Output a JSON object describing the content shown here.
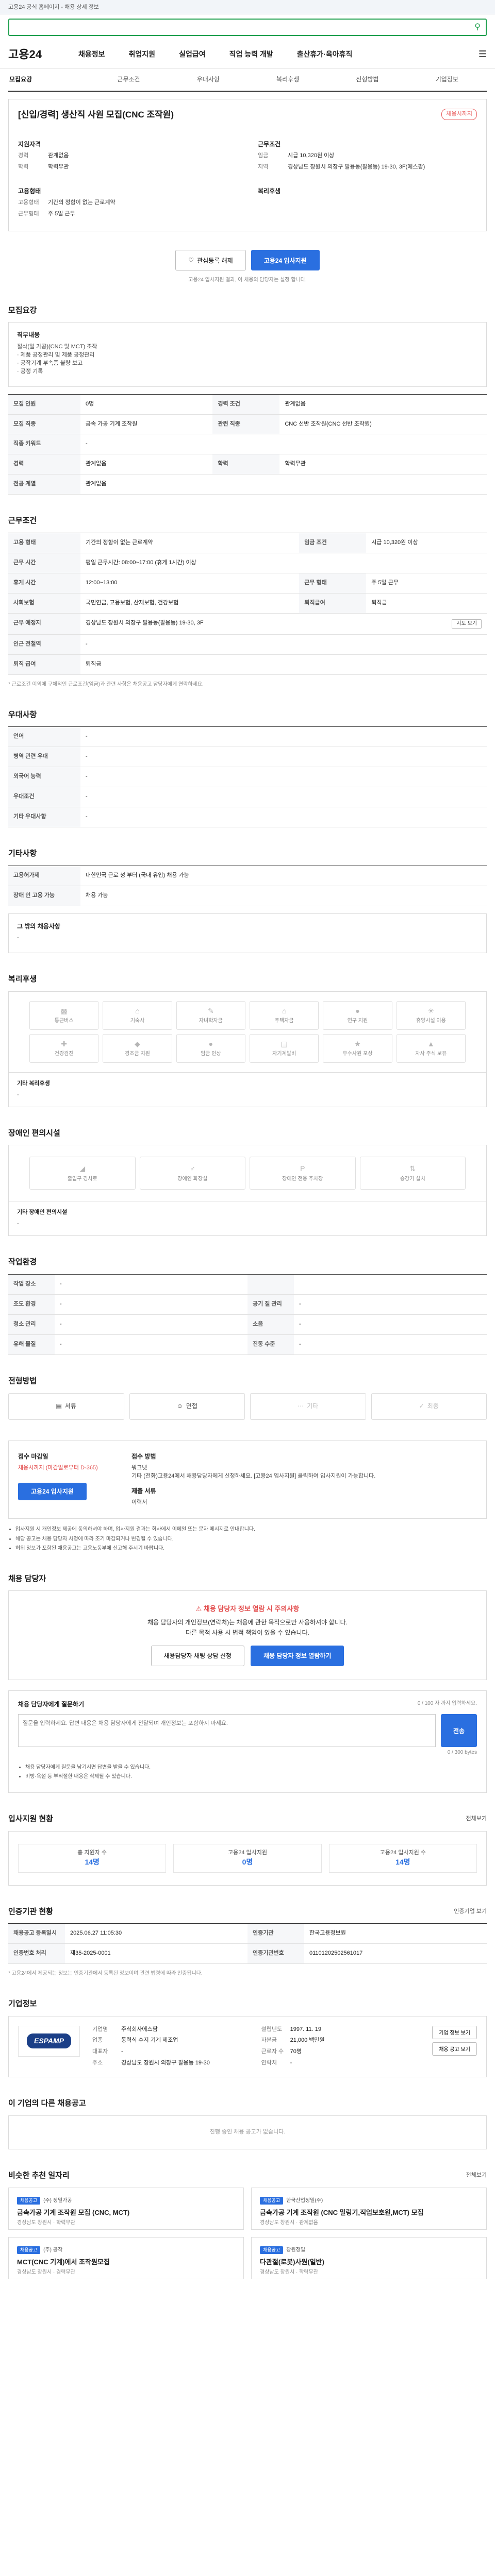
{
  "topbar": {
    "text": "고용24 공식 홈페이지 - 채용 상세 정보"
  },
  "search": {
    "placeholder": ""
  },
  "gnb": {
    "logo": "고용24",
    "items": [
      "채용정보",
      "취업지원",
      "실업급여",
      "직업 능력 개발",
      "출산휴가·육아휴직"
    ]
  },
  "tabs": [
    "모집요강",
    "근무조건",
    "우대사항",
    "복리후생",
    "전형방법",
    "기업정보"
  ],
  "title": {
    "job_title": "[신입/경력] 생산직 사원 모집(CNC 조작원)",
    "deadline": "채용시까지"
  },
  "summary": {
    "left_heading": "지원자격",
    "right_heading": "근무조건",
    "rows_left": [
      [
        "경력",
        "관계없음"
      ],
      [
        "학력",
        "학력무관"
      ]
    ],
    "rows_right": [
      [
        "임금",
        "시급 10,320원 이상"
      ],
      [
        "지역",
        "경상남도 창원시 의창구 팔용동(팔용동) 19-30, 3F(에스팜)"
      ]
    ],
    "left_heading2": "고용형태",
    "right_heading2": "복리후생",
    "rows_left2": [
      [
        "고용형태",
        "기간의 정함이 없는 근로계약"
      ],
      [
        "근무형태",
        "주 5일 근무"
      ]
    ]
  },
  "actions": {
    "scrap": "관심등록 해제",
    "apply": "고용24 입사지원"
  },
  "apply_note": "고용24 입사지원 결과, 이 채용의 담당자는 설정 합니다.",
  "recruit": {
    "section": "모집요강",
    "duty_title": "직무내용",
    "duty_lines": [
      "절삭(일 가공)(CNC 및 MCT) 조작",
      "· 제품 공정관리 및 제품 공정관리",
      "· 공작기계 부속품 불량 보고",
      "· 공정 기록"
    ],
    "rows": [
      [
        "모집 인원",
        "0명",
        "경력 조건",
        "관계없음"
      ],
      [
        "모집 직종",
        "금속 가공 기계 조작원",
        "관련 직종",
        "CNC 선반 조작원(CNC 선반 조작원)"
      ],
      [
        "직종 키워드",
        "-",
        "",
        ""
      ],
      [
        "경력",
        "관계없음",
        "학력",
        "학력무관"
      ],
      [
        "전공 계열",
        "관계없음",
        "",
        ""
      ]
    ]
  },
  "work": {
    "section": "근무조건",
    "rows": [
      [
        "고용 형태",
        "기간의 정함이 없는 근로계약",
        "임금 조건",
        "시급 10,320원 이상"
      ],
      [
        "근무 시간",
        "평일 근무시간: 08:00~17:00 (휴게 1시간) 이상",
        "",
        ""
      ],
      [
        "휴게 시간",
        "12:00~13:00",
        "근무 형태",
        "주 5일 근무"
      ],
      [
        "사회보험",
        "국민연금, 고용보험, 산재보험, 건강보험",
        "퇴직급여",
        "퇴직금"
      ],
      [
        "근무 예정지",
        "경상남도 창원시 의창구 팔용동(팔용동) 19-30, 3F",
        "",
        ""
      ],
      [
        "인근 전철역",
        "-",
        "",
        ""
      ],
      [
        "퇴직 급여",
        "퇴직금",
        "",
        ""
      ]
    ],
    "map_btn": "지도 보기",
    "note": "* 근로조건 이외에 구체적인 근로조건(임금)과 관련 사항은 채용공고 담당자에게 연락하세요."
  },
  "prefer": {
    "section": "우대사항",
    "rows": [
      [
        "언어",
        "-"
      ],
      [
        "병역 관련 우대",
        "-"
      ],
      [
        "외국어 능력",
        "-"
      ],
      [
        "우대조건",
        "-"
      ],
      [
        "기타 우대사항",
        "-"
      ]
    ]
  },
  "etc": {
    "section": "기타사항",
    "rows": [
      [
        "고용허가제",
        "대한민국 근로 성 부터 (국내 유입) 채용 가능"
      ],
      [
        "장애 인 고용 가능",
        "채용 가능"
      ]
    ],
    "sub_title": "그 밖의 채용사항",
    "sub_text": "-"
  },
  "welfare": {
    "section": "복리후생",
    "items": [
      "통근버스",
      "기숙사",
      "자녀학자금",
      "주택자금",
      "연구 지원",
      "휴양시설 이용",
      "건강검진",
      "경조금 지원",
      "임금 인상",
      "자기계발비",
      "우수사원 포상",
      "자사 주식 보유"
    ],
    "sub_title": "기타 복리후생",
    "sub_text": "-"
  },
  "disability": {
    "section": "장애인 편의시설",
    "items": [
      "출입구 경사로",
      "장애인 화장실",
      "장애인 전용 주차장",
      "승강기 설치"
    ],
    "sub_title": "기타 장애인 편의시설",
    "sub_text": "-"
  },
  "env": {
    "section": "작업환경",
    "rows": [
      [
        "작업 장소",
        "-",
        "",
        ""
      ],
      [
        "조도 환경",
        "-",
        "공기 질 관리",
        "-"
      ],
      [
        "청소 관리",
        "-",
        "소음",
        "-"
      ],
      [
        "유해 물질",
        "-",
        "진동 수준",
        "-"
      ]
    ]
  },
  "process": {
    "section": "전형방법",
    "steps": [
      "서류",
      "면접",
      "기타",
      "최종"
    ]
  },
  "apply": {
    "left_title": "접수 마감일",
    "left_text": "채용시까지 (마감일로부터 D-365)",
    "apply_btn": "고용24 입사지원",
    "right_title": "접수 방법",
    "right_lines": [
      "워크넷",
      "기타 (전화)고용24에서 채용담당자에게 신청하세요. [고용24 입사지원] 클릭하여 입사지원이 가능합니다."
    ],
    "doc_title": "제출 서류",
    "doc_text": "이력서",
    "bullets": [
      "입사지원 시 개인정보 제공에 동의하셔야 하며, 입사지원 결과는 회사에서 이메일 또는 문자 메시지로 안내합니다.",
      "해당 공고는 채용 담당자 사정에 따라 조기 마감되거나 변경될 수 있습니다.",
      "허위 정보가 포함된 채용공고는 고용노동부에 신고해 주시기 바랍니다."
    ]
  },
  "manager": {
    "section": "채용 담당자",
    "badge": "채용 담당자 정보 열람 시 주의사항",
    "text1": "채용 담당자의 개인정보(연락처)는 채용에 관한 목적으로만 사용하셔야 합니다.",
    "text2": "다른 목적 사용 시 법적 책임이 있을 수 있습니다.",
    "btn_chat": "채용담당자 채팅 상담 신청",
    "btn_view": "채용 담당자 정보 열람하기",
    "q_title": "채용 담당자에게 질문하기",
    "q_hint": "0 / 100 자 까지 입력하세요.",
    "q_placeholder": "질문을 입력하세요. 답변 내용은 채용 담당자에게 전달되며 개인정보는 포함하지 마세요.",
    "q_btn": "전송",
    "q_counter": "0 / 300 bytes",
    "notes": [
      "채용 담당자에게 질문을 남기시면 답변을 받을 수 있습니다.",
      "비방·욕설 등 부적절한 내용은 삭제될 수 있습니다."
    ]
  },
  "stats": {
    "section": "입사지원 현황",
    "right": "전체보기",
    "items": [
      [
        "총 지원자 수",
        "14명"
      ],
      [
        "고용24 입사지원",
        "0명"
      ],
      [
        "고용24 입사지원 수",
        "14명"
      ]
    ]
  },
  "cert": {
    "section": "인증기관 현황",
    "right": "인증기업 보기",
    "rows": [
      [
        "채용공고 등록일시",
        "2025.06.27 11:05:30",
        "인증기관",
        "한국고용정보원"
      ],
      [
        "인증번호 처리",
        "제35-2025-0001",
        "인증기관번호",
        "01101202502561017"
      ]
    ],
    "note": "* 고용24에서 제공되는 정보는 인증기관에서 등록된 정보이며 관련 법령에 따라 인증됩니다."
  },
  "company": {
    "section": "기업정보",
    "logo_text": "ESPAMP",
    "btn_info": "기업 정보 보기",
    "btn_jobs": "채용 공고 보기",
    "rows": [
      [
        "기업명",
        "주식회사에스팜"
      ],
      [
        "업종",
        "동력식 수지 기계 제조업"
      ],
      [
        "대표자",
        "-"
      ],
      [
        "설립년도",
        "1997. 11. 19"
      ],
      [
        "자본금",
        "21,000 백만원"
      ],
      [
        "근로자 수",
        "70명"
      ],
      [
        "주소",
        "경상남도 창원시 의창구 팔용동 19-30"
      ],
      [
        "연락처",
        "-"
      ]
    ]
  },
  "other_jobs": {
    "section": "이 기업의 다른 채용공고",
    "empty": "진행 중인 채용 공고가 없습니다."
  },
  "recommend": {
    "section": "비슷한 추천 일자리",
    "right": "전체보기",
    "items": [
      {
        "tag": "채용공고",
        "co": "(주) 정밀가공",
        "title": "금속가공 기계 조작원 모집 (CNC, MCT)",
        "meta": "경상남도 창원시 · 학력무관"
      },
      {
        "tag": "채용공고",
        "co": "한국산업정밀(주)",
        "title": "금속가공 기계 조작원 (CNC 밀링기,직업보호원,MCT) 모집",
        "meta": "경상남도 창원시 · 관계없음"
      },
      {
        "tag": "채용공고",
        "co": "(주) 공작",
        "title": "MCT(CNC 기계)에서 조작원모집",
        "meta": "경상남도 창원시 · 경력무관"
      },
      {
        "tag": "채용공고",
        "co": "창원정밀",
        "title": "다관절(로봇)사원(일반)",
        "meta": "경상남도 창원시 · 학력무관"
      }
    ]
  }
}
